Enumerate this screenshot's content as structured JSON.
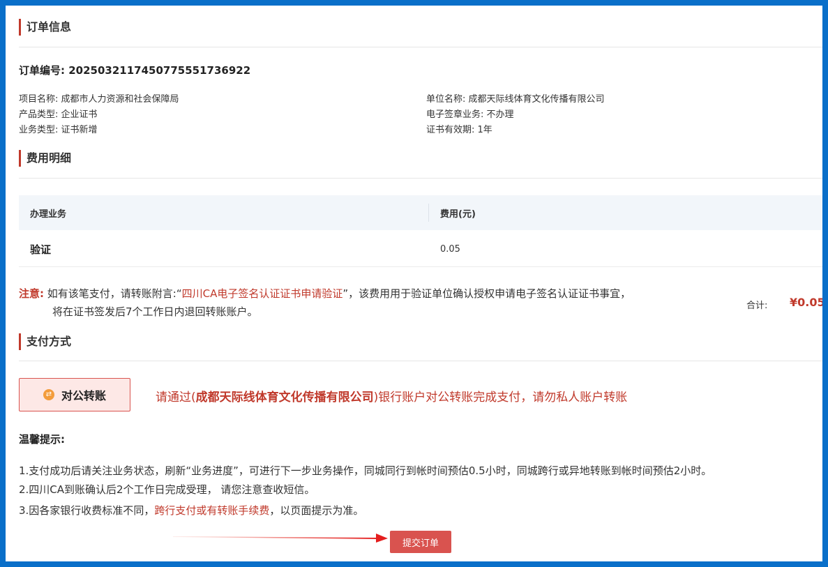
{
  "order_section": {
    "title": "订单信息",
    "order_number_label": "订单编号:",
    "order_number": "20250321174507755517369​22",
    "project_name_label": "项目名称:",
    "project_name": "成都市人力资源和社会保障局",
    "product_type_label": "产品类型:",
    "product_type": "企业证书",
    "business_type_label": "业务类型:",
    "business_type": "证书新增",
    "unit_name_label": "单位名称:",
    "unit_name": "成都天际线体育文化传播有限公司",
    "esign_label": "电子签章业务:",
    "esign_value": "不办理",
    "validity_label": "证书有效期:",
    "validity_value": "1年"
  },
  "fee_section": {
    "title": "费用明细",
    "columns": [
      "办理业务",
      "费用(元)"
    ],
    "rows": [
      {
        "business": "验证",
        "fee": "0.05"
      }
    ],
    "note_label": "注意:",
    "note_prefix": "如有该笔支付，请转账附言:“",
    "note_highlight": "四川CA电子签名认证证书申请验证",
    "note_suffix": "”，该费用用于验证单位确认授权申请电子签名认证证书事宜，",
    "note_line2": "将在证书签发后7个工作日内退回转账账户。",
    "total_label": "合计:",
    "total_value": "¥0.05"
  },
  "payment_section": {
    "title": "支付方式",
    "method_label": "对公转账",
    "msg_prefix": "请通过(",
    "msg_company": "成都天际线体育文化传播有限公司",
    "msg_suffix": ")银行账户对公转账完成支付，请勿私人账户转账"
  },
  "tips": {
    "title": "温馨提示:",
    "line1": "1.支付成功后请关注业务状态，刷新“业务进度”，可进行下一步业务操作，同城同行到帐时间预估0.5小时，同城跨行或异地转账到帐时间预估2小时。",
    "line2": "2.四川CA到账确认后2个工作日完成受理， 请您注意查收短信。",
    "line3_prefix": "3.因各家银行收费标准不同，",
    "line3_highlight": "跨行支付或有转账手续费",
    "line3_suffix": "，以页面提示为准。"
  },
  "submit_label": "提交订单",
  "colors": {
    "frame_blue": "#0a6fc9",
    "accent_red": "#c0392b",
    "button_red": "#d9534f"
  }
}
